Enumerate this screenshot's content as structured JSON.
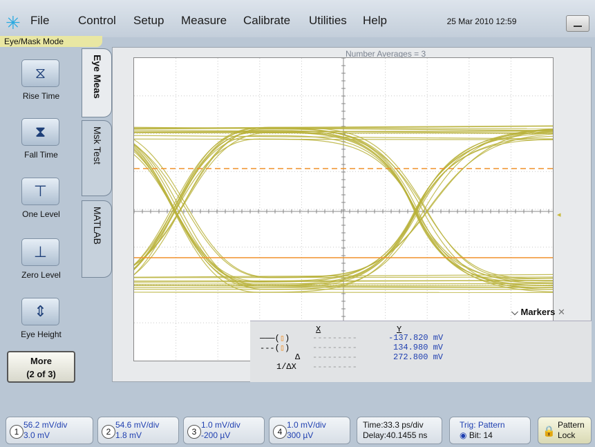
{
  "menu": {
    "items": [
      "File",
      "Control",
      "Setup",
      "Measure",
      "Calibrate",
      "Utilities",
      "Help"
    ],
    "datetime": "25 Mar 2010  12:59"
  },
  "mode_label": "Eye/Mask Mode",
  "tabs": [
    "Eye Meas",
    "Msk Test",
    "MATLAB"
  ],
  "measure_buttons": [
    "Rise Time",
    "Fall Time",
    "One Level",
    "Zero Level",
    "Eye Height"
  ],
  "more_button": {
    "line1": "More",
    "line2": "(2 of 3)"
  },
  "number_averages": "Number Averages =  3",
  "markers": {
    "title": "Markers",
    "col_x": "X",
    "col_y": "Y",
    "rows": [
      {
        "y": "-137.820 mV"
      },
      {
        "y": "134.980 mV"
      },
      {
        "label": "Δ",
        "y": "272.800 mV"
      },
      {
        "label": "1/ΔX",
        "y": ""
      }
    ]
  },
  "channels": [
    {
      "num": "1",
      "scale": "56.2 mV/div",
      "offset": "3.0 mV"
    },
    {
      "num": "2",
      "scale": "54.6 mV/div",
      "offset": "1.8 mV"
    },
    {
      "num": "3",
      "scale": "1.0 mV/div",
      "offset": "-200 µV"
    },
    {
      "num": "4",
      "scale": "1.0 mV/div",
      "offset": "300 µV"
    }
  ],
  "timebase": {
    "time": "Time:33.3 ps/div",
    "delay": "Delay:40.1455 ns"
  },
  "trigger": {
    "line1": "Trig: Pattern",
    "line2": "Bit:  14"
  },
  "pattern_lock": {
    "line1": "Pattern",
    "line2": "Lock"
  },
  "colors": {
    "trace": "#b9b13a",
    "marker": "#f0902a",
    "channel_text": "#1f3fb0"
  }
}
